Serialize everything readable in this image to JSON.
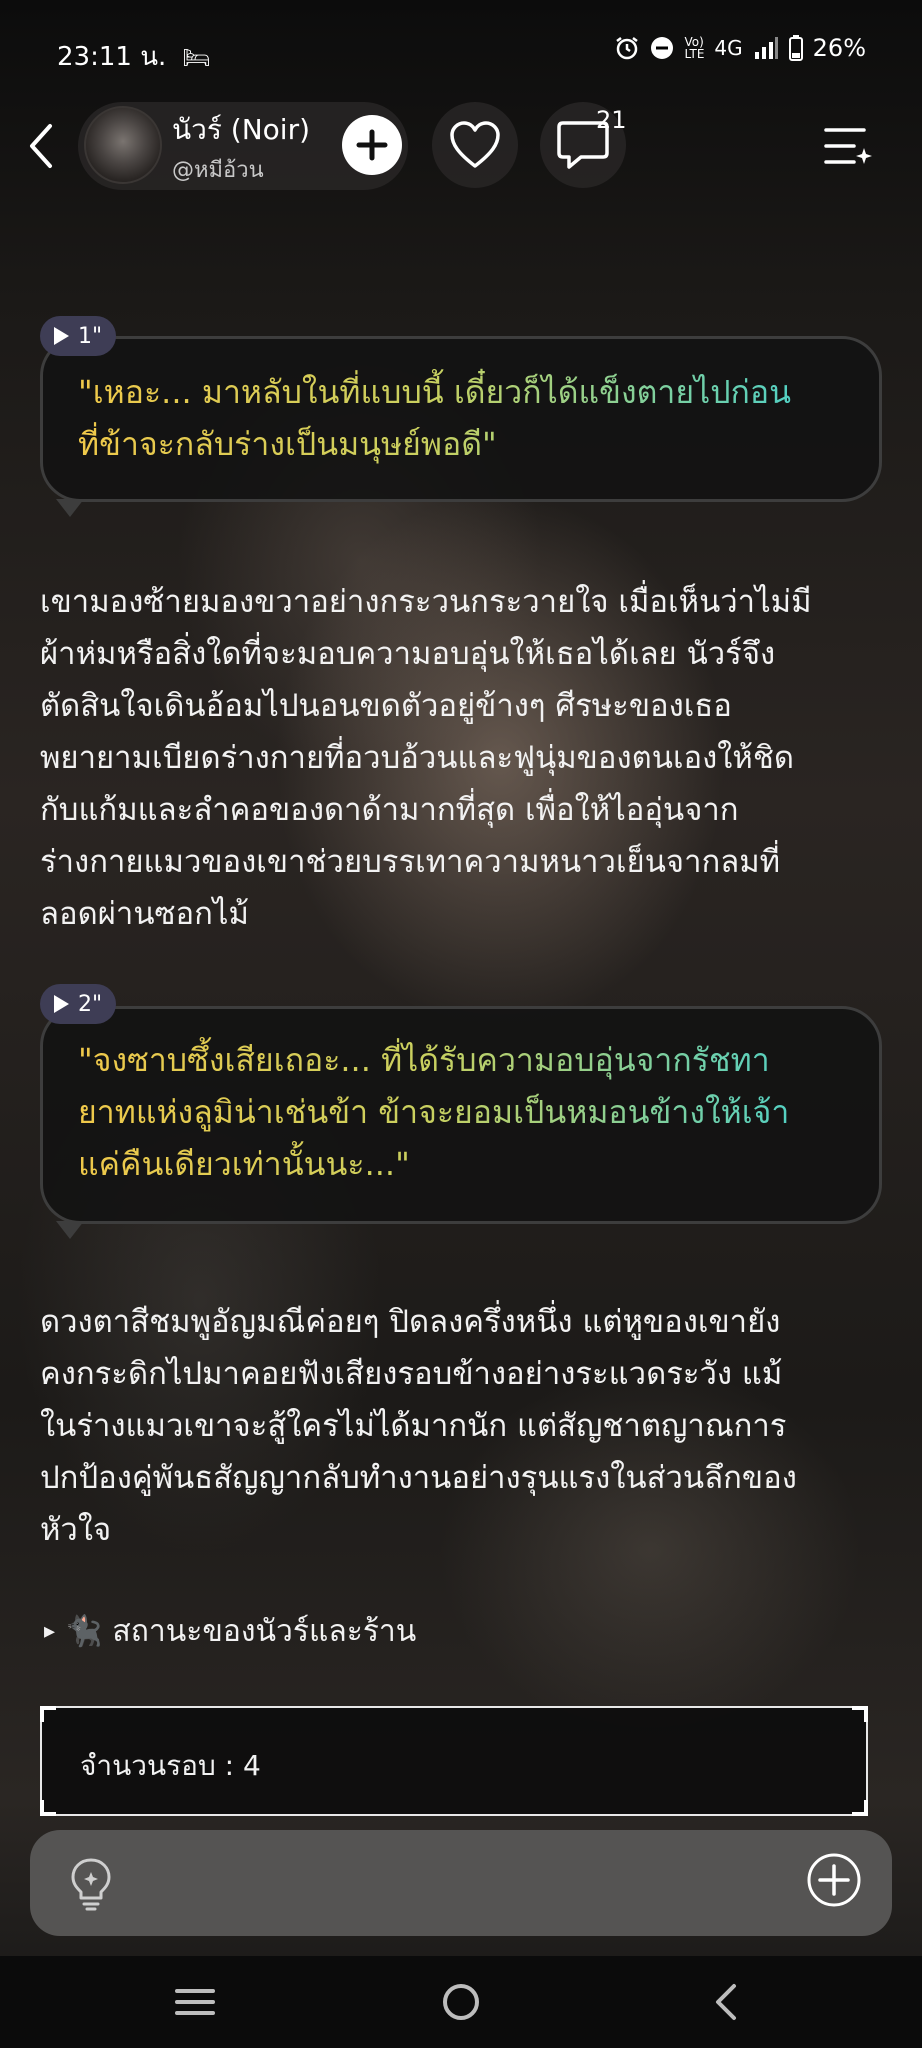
{
  "status_bar": {
    "time": "23:11 น.",
    "battery": "26%",
    "network": "4G"
  },
  "header": {
    "character_name": "นัวร์ (Noir)",
    "handle": "@หมีอ้วน",
    "comment_count": "21"
  },
  "messages": [
    {
      "tag": "1\"",
      "line1": "\"เหอะ... มาหลับในที่แบบนี้ เดี๋ยวก็ได้แข็งตายไปก่อน",
      "line2": "ที่ข้าจะกลับร่างเป็นมนุษย์พอดี\""
    },
    {
      "tag": "2\"",
      "line1": "\"จงซาบซึ้งเสียเถอะ... ที่ได้รับความอบอุ่นจากรัชทา",
      "line2": "ยาทแห่งลูมิน่าเช่นข้า ข้าจะยอมเป็นหมอนข้างให้เจ้า",
      "line3": "แค่คืนเดียวเท่านั้นนะ...\""
    }
  ],
  "narration1": [
    "เขามองซ้ายมองขวาอย่างกระวนกระวายใจ เมื่อเห็นว่าไม่มี",
    "ผ้าห่มหรือสิ่งใดที่จะมอบความอบอุ่นให้เธอได้เลย นัวร์จึง",
    "ตัดสินใจเดินอ้อมไปนอนขดตัวอยู่ข้างๆ ศีรษะของเธอ",
    "พยายามเบียดร่างกายที่อวบอ้วนและฟูนุ่มของตนเองให้ชิด",
    "กับแก้มและลำคอของดาด้ามากที่สุด เพื่อให้ไออุ่นจาก",
    "ร่างกายแมวของเขาช่วยบรรเทาความหนาวเย็นจากลมที่",
    "ลอดผ่านซอกไม้"
  ],
  "narration2": [
    "ดวงตาสีชมพูอัญมณีค่อยๆ ปิดลงครึ่งหนึ่ง แต่หูของเขายัง",
    "คงกระดิกไปมาคอยฟังเสียงรอบข้างอย่างระแวดระวัง แม้",
    "ในร่างแมวเขาจะสู้ใครไม่ได้มากนัก แต่สัญชาตญาณการ",
    "ปกป้องคู่พันธสัญญากลับทำงานอย่างรุนแรงในส่วนลึกของ",
    "หัวใจ"
  ],
  "status_section": {
    "arrow": "▸",
    "emoji": "🐈‍⬛",
    "label": "สถานะของนัวร์และร้าน"
  },
  "round_count": "จำนวนรอบ : 4",
  "colors": {
    "accent_yellow": "#f0c94a",
    "accent_cyan": "#3ad0d8",
    "tag_bg": "#3e3d55"
  },
  "icons": [
    "back-arrow-icon",
    "plus-icon",
    "heart-icon",
    "comment-icon",
    "menu-sparkle-icon",
    "lightbulb-icon",
    "add-circle-icon",
    "recent-apps-icon",
    "home-icon",
    "nav-back-icon"
  ]
}
